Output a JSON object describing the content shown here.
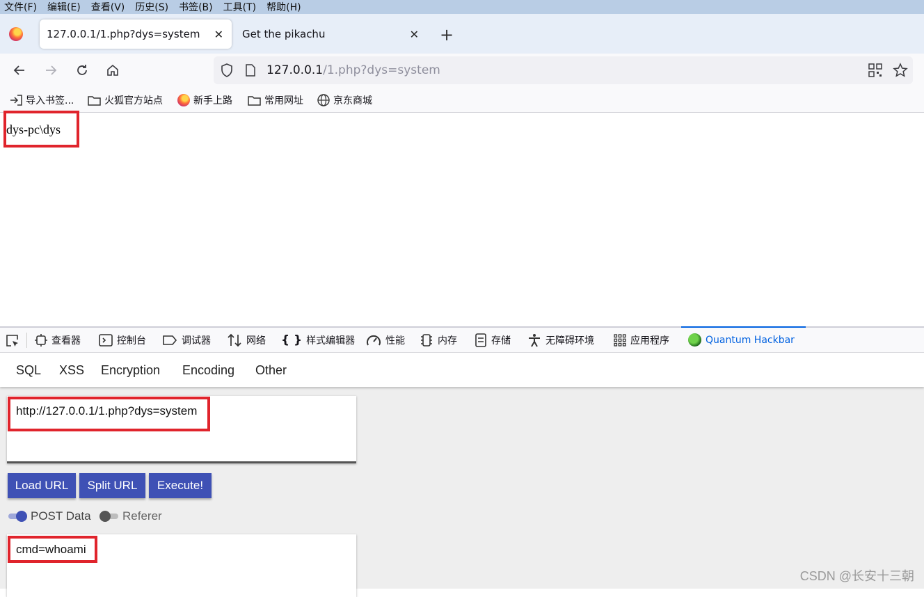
{
  "menubar": [
    "文件(F)",
    "编辑(E)",
    "查看(V)",
    "历史(S)",
    "书签(B)",
    "工具(T)",
    "帮助(H)"
  ],
  "tabs": [
    {
      "title": "127.0.0.1/1.php?dys=system",
      "active": true
    },
    {
      "title": "Get the pikachu",
      "active": false
    }
  ],
  "address": {
    "host": "127.0.0.1",
    "path": "/1.php?dys=system"
  },
  "bookmarks": [
    {
      "label": "导入书签...",
      "icon": "import-icon"
    },
    {
      "label": "火狐官方站点",
      "icon": "folder-icon"
    },
    {
      "label": "新手上路",
      "icon": "firefox-icon"
    },
    {
      "label": "常用网址",
      "icon": "folder-icon"
    },
    {
      "label": "京东商城",
      "icon": "globe-icon"
    }
  ],
  "page": {
    "output": "dys-pc\\dys"
  },
  "devtools": {
    "tabs": [
      {
        "label": "查看器",
        "icon": "inspector-icon"
      },
      {
        "label": "控制台",
        "icon": "console-icon"
      },
      {
        "label": "调试器",
        "icon": "debugger-icon"
      },
      {
        "label": "网络",
        "icon": "network-icon"
      },
      {
        "label": "样式编辑器",
        "icon": "braces-icon"
      },
      {
        "label": "性能",
        "icon": "gauge-icon"
      },
      {
        "label": "内存",
        "icon": "memory-icon"
      },
      {
        "label": "存储",
        "icon": "storage-icon"
      },
      {
        "label": "无障碍环境",
        "icon": "accessibility-icon"
      },
      {
        "label": "应用程序",
        "icon": "grid-icon"
      },
      {
        "label": "Quantum Hackbar",
        "icon": "hackbar-icon",
        "active": true
      }
    ]
  },
  "hackbar": {
    "menu": [
      "SQL",
      "XSS",
      "Encryption",
      "Encoding",
      "Other"
    ],
    "url_value": "http://127.0.0.1/1.php?dys=system",
    "buttons": [
      "Load URL",
      "Split URL",
      "Execute!"
    ],
    "toggles": [
      {
        "label": "POST Data",
        "on": true
      },
      {
        "label": "Referer",
        "on": false
      }
    ],
    "post_value": "cmd=whoami",
    "accent": "#3f51b5"
  },
  "watermark": "CSDN @长安十三朝"
}
